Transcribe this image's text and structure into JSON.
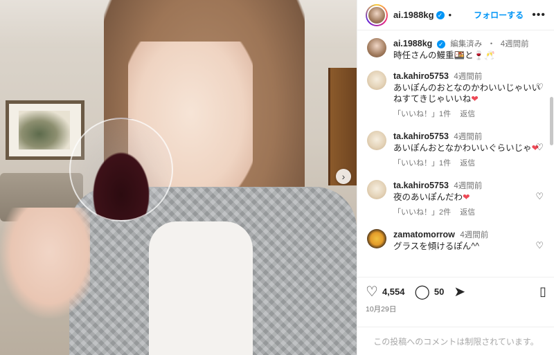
{
  "photo": {
    "alt_description": "",
    "next_icon": "chevron-right-icon"
  },
  "header": {
    "username": "ai.1988kg",
    "verified": true,
    "dot": "•",
    "follow_label": "フォローする",
    "more_label": "•••"
  },
  "caption": {
    "username": "ai.1988kg",
    "edited": "編集済み",
    "separator": "・",
    "time": "4週間前",
    "text": "時任さんの鰻重🍱と🍷🥂"
  },
  "comments": [
    {
      "username": "ta.kahiro5753",
      "time": "4週間前",
      "text": "あいぽんのおとなのかわいいじゃいいねすてきじゃいいね",
      "emoji": "❤",
      "likes": "「いいね！」1件",
      "reply": "返信",
      "avatar": "dog"
    },
    {
      "username": "ta.kahiro5753",
      "time": "4週間前",
      "text": "あいぽんおとなかわいいぐらいじゃ",
      "emoji": "❤",
      "likes": "「いいね！」1件",
      "reply": "返信",
      "avatar": "dog"
    },
    {
      "username": "ta.kahiro5753",
      "time": "4週間前",
      "text": "夜のあいぽんだわ",
      "emoji": "❤",
      "likes": "「いいね！」2件",
      "reply": "返信",
      "avatar": "dog"
    },
    {
      "username": "zamatomorrow",
      "time": "4週間前",
      "text": "グラスを傾けるぽん^^",
      "emoji": "",
      "likes": "",
      "reply": "",
      "avatar": "cartoon"
    }
  ],
  "actions": {
    "like_icon": "heart-icon",
    "like_count": "4,554",
    "comment_icon": "comment-icon",
    "comment_count": "50",
    "share_icon": "share-icon",
    "bookmark_icon": "bookmark-icon",
    "date": "10月29日"
  },
  "footer": {
    "text": "この投稿へのコメントは制限されています。"
  },
  "colors": {
    "accent": "#0095f6",
    "heart": "#ed4956",
    "muted": "#737373"
  }
}
